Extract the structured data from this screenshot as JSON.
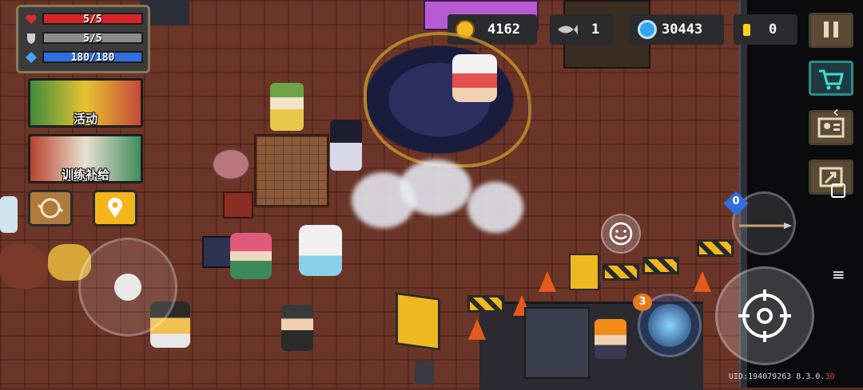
{
  "player_stats": {
    "hp": {
      "text": "5/5",
      "current": 5,
      "max": 5
    },
    "armor": {
      "text": "5/5",
      "current": 5,
      "max": 5
    },
    "energy": {
      "text": "180/180",
      "current": 180,
      "max": 180
    }
  },
  "side_menu": {
    "events_label": "活动",
    "training_label": "训练补给"
  },
  "currencies": {
    "gold": "4162",
    "fish": "1",
    "gems": "30443",
    "tokens": "0"
  },
  "footer": {
    "uid_text": "UID:194079263 8.3.0.",
    "uid_suffix": "30"
  },
  "buttons": {
    "skill_charges": "0",
    "weapon_swap_badge": "3"
  },
  "colors": {
    "hp": "#d8242a",
    "armor": "#8c8c8c",
    "energy": "#2f6fe0",
    "gold": "#f2b824",
    "gem": "#33a6f0",
    "token": "#f6d21a"
  },
  "icons": [
    "heart-icon",
    "shield-icon",
    "diamond-icon",
    "gold-coin-icon",
    "fish-icon",
    "gem-icon",
    "token-icon",
    "pause-icon",
    "shop-icon",
    "profile-card-icon",
    "exit-icon",
    "emote-icon",
    "crosshair-icon",
    "spear-icon",
    "location-pin-icon",
    "swap-icon"
  ]
}
